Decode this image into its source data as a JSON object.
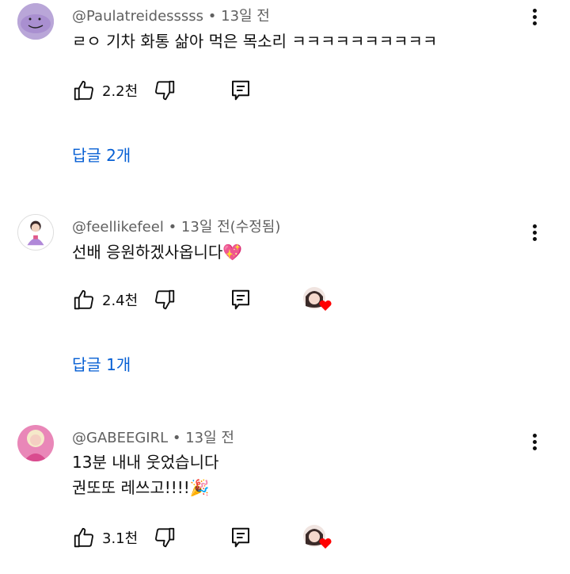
{
  "comments": [
    {
      "handle": "@Paulatreidesssss",
      "time": "13일 전",
      "lines": [
        "ㄹㅇ 기차 화통 삶아 먹은 목소리 ㅋㅋㅋㅋㅋㅋㅋㅋㅋㅋ"
      ],
      "likes": "2.2천",
      "replies": "답글 2개",
      "hearted": false
    },
    {
      "handle": "@feellikefeel",
      "time": "13일 전(수정됨)",
      "lines": [
        "선배 응원하겠사옵니다💖"
      ],
      "likes": "2.4천",
      "replies": "답글 1개",
      "hearted": true
    },
    {
      "handle": "@GABEEGIRL",
      "time": "13일 전",
      "lines": [
        "13분 내내 웃었습니다",
        "권또또 레쓰고!!!!🎉"
      ],
      "likes": "3.1천",
      "replies": "",
      "hearted": true
    }
  ],
  "colors": {
    "link": "#065fd4",
    "meta": "#606060",
    "heart": "#ff0000"
  },
  "icons": [
    "thumbs-up-icon",
    "thumbs-down-icon",
    "reply-icon",
    "more-vert-icon",
    "creator-heart-icon"
  ]
}
